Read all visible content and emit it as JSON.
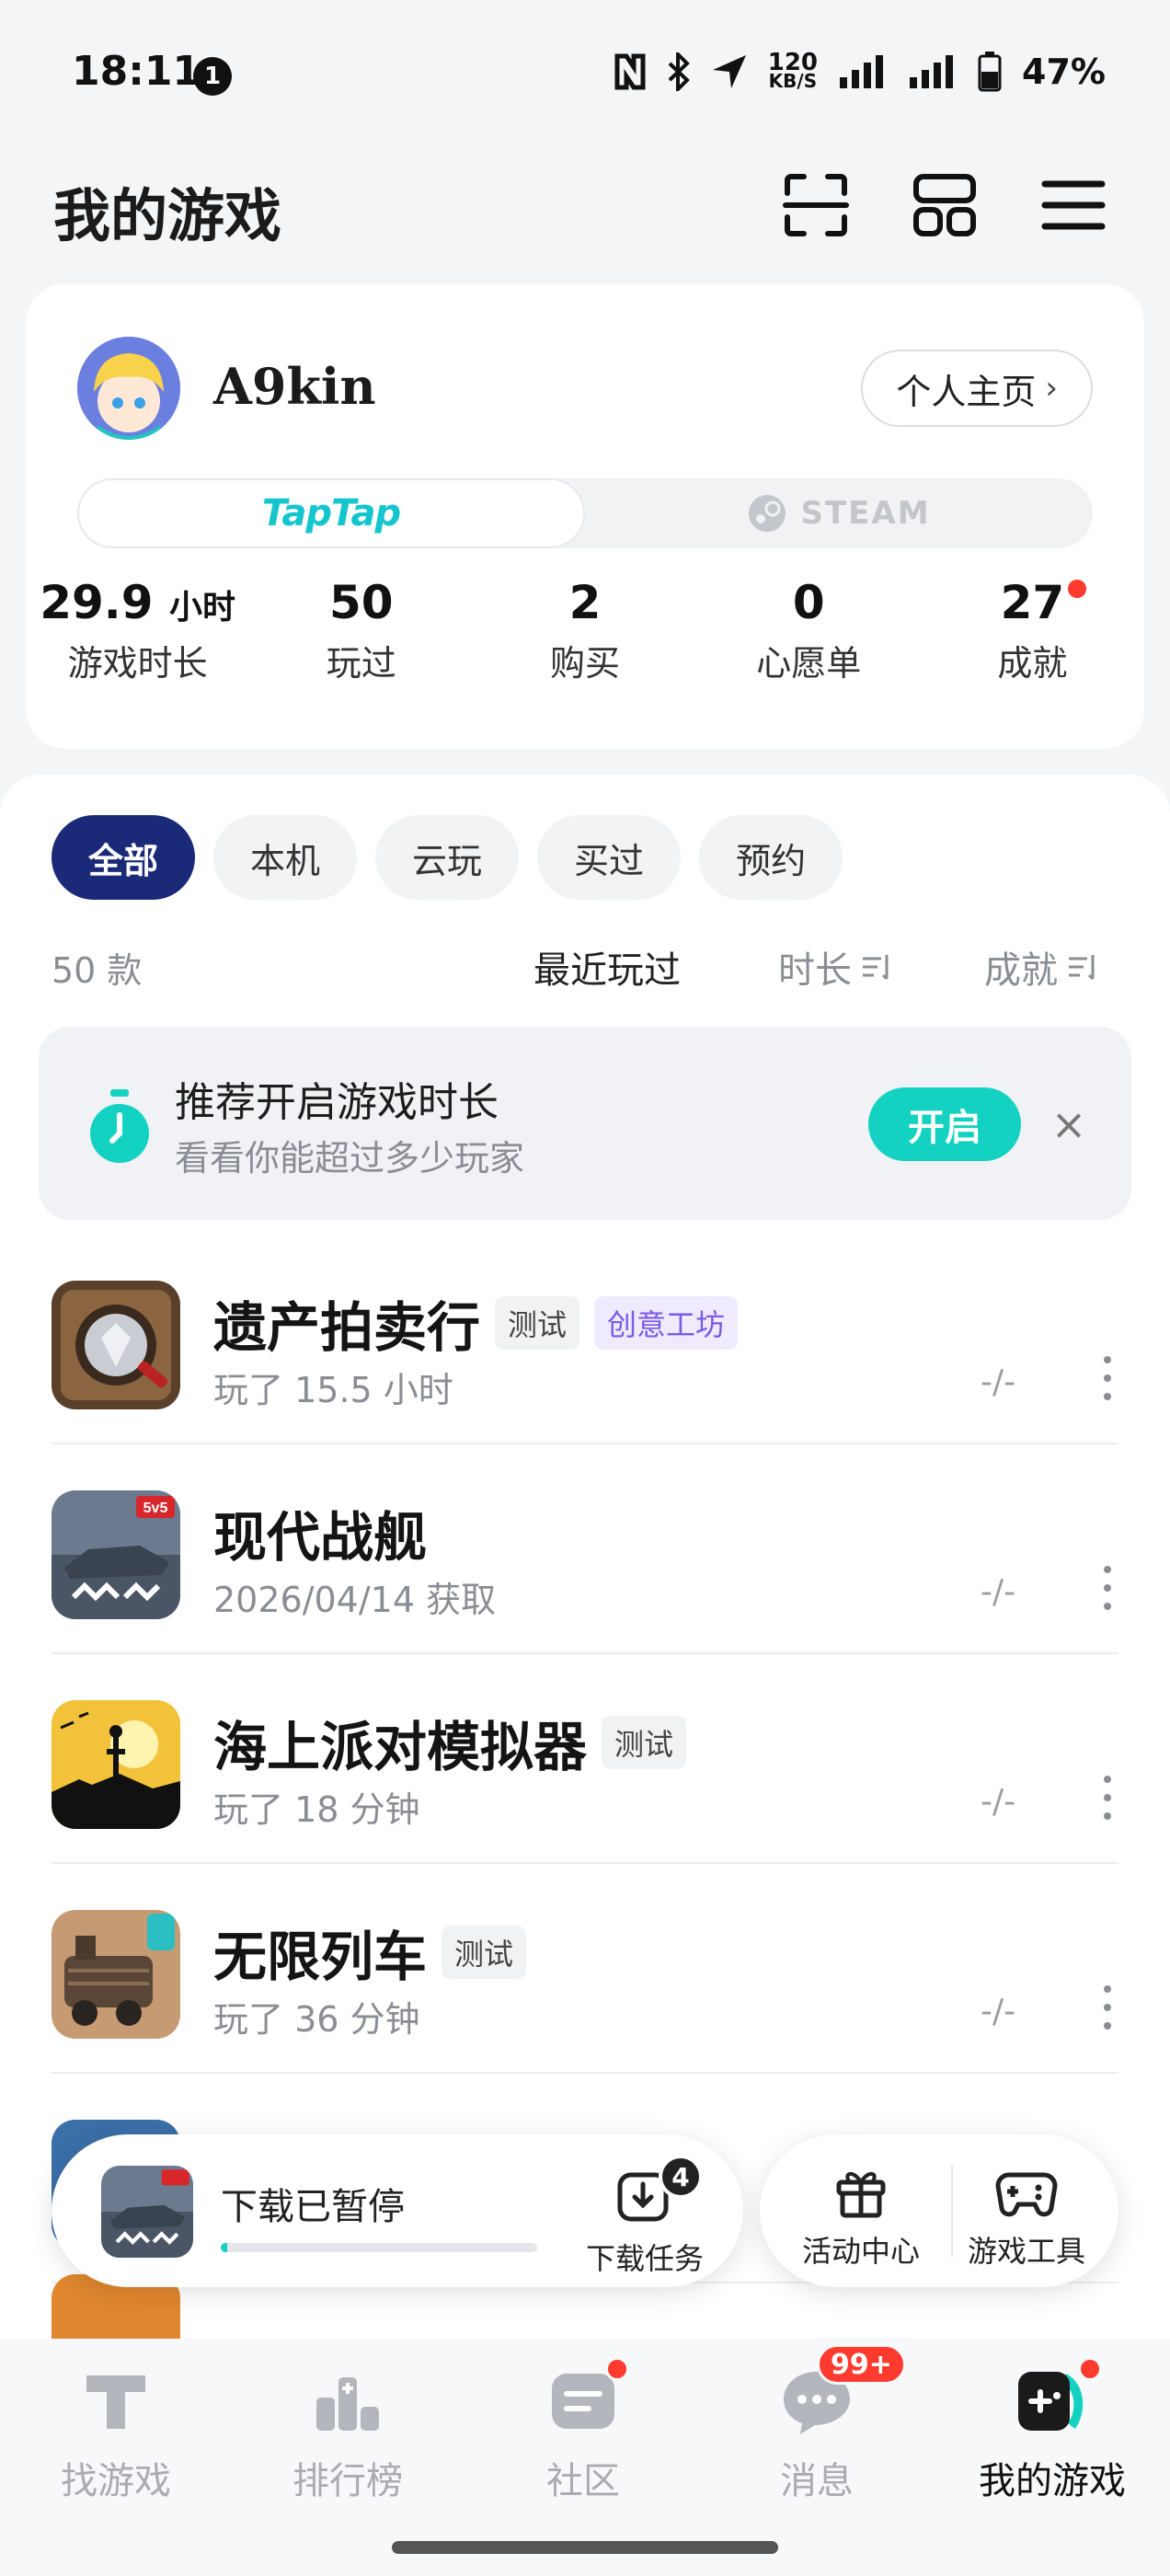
{
  "status_bar": {
    "time": "18:11",
    "notif_count": "1",
    "net_speed_top": "120",
    "net_speed_bottom": "KB/S",
    "battery": "47%"
  },
  "header": {
    "title": "我的游戏",
    "icons": [
      "scan-icon",
      "grid-icon",
      "menu-icon"
    ]
  },
  "profile": {
    "username": "A9kin",
    "home_button": "个人主页",
    "platforms": {
      "taptap": "TapTap",
      "steam": "STEAM",
      "active": "taptap"
    },
    "stats": [
      {
        "value": "29.9",
        "unit": "小时",
        "label": "游戏时长"
      },
      {
        "value": "50",
        "unit": "",
        "label": "玩过"
      },
      {
        "value": "2",
        "unit": "",
        "label": "购买"
      },
      {
        "value": "0",
        "unit": "",
        "label": "心愿单"
      },
      {
        "value": "27",
        "unit": "",
        "label": "成就",
        "has_dot": true
      }
    ]
  },
  "filters": {
    "items": [
      "全部",
      "本机",
      "云玩",
      "买过",
      "预约"
    ],
    "active": "全部"
  },
  "list_meta": {
    "count": "50 款",
    "sort_recent": "最近玩过",
    "sort_duration": "时长",
    "sort_achievement": "成就"
  },
  "promo": {
    "title": "推荐开启游戏时长",
    "subtitle": "看看你能超过多少玩家",
    "button": "开启"
  },
  "games": [
    {
      "title": "遗产拍卖行",
      "tags": [
        "测试",
        "创意工坊"
      ],
      "sub": "玩了 15.5 小时",
      "progress": "-/-"
    },
    {
      "title": "现代战舰",
      "tags": [],
      "sub": "2026/04/14 获取",
      "progress": "-/-"
    },
    {
      "title": "海上派对模拟器",
      "tags": [
        "测试"
      ],
      "sub": "玩了 18 分钟",
      "progress": "-/-"
    },
    {
      "title": "无限列车",
      "tags": [
        "测试"
      ],
      "sub": "玩了 36 分钟",
      "progress": "-/-"
    }
  ],
  "download": {
    "status": "下载已暂停",
    "task_label": "下载任务",
    "task_count": "4",
    "progress": 0.02
  },
  "tools": {
    "activity": "活动中心",
    "game_tools": "游戏工具"
  },
  "colors": {
    "accent": "#14d2c2",
    "chip_active": "#1a2a78",
    "badge": "#ff3b30"
  },
  "bottom_nav": {
    "items": [
      {
        "label": "找游戏",
        "icon": "find-game-icon"
      },
      {
        "label": "排行榜",
        "icon": "ranking-icon"
      },
      {
        "label": "社区",
        "icon": "community-icon",
        "dot": true
      },
      {
        "label": "消息",
        "icon": "message-icon",
        "badge": "99+"
      },
      {
        "label": "我的游戏",
        "icon": "my-games-icon",
        "dot": true
      }
    ],
    "active": "我的游戏"
  }
}
